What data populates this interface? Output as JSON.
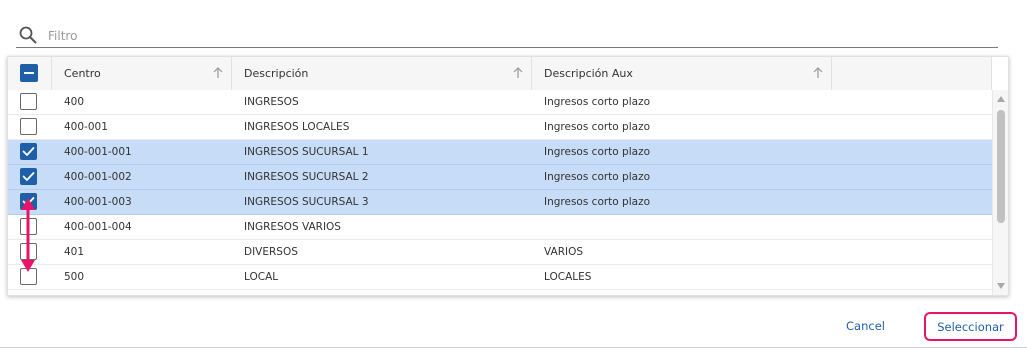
{
  "filter": {
    "placeholder": "Filtro",
    "value": ""
  },
  "grid": {
    "columns": [
      {
        "key": "centro",
        "label": "Centro",
        "sortable": true
      },
      {
        "key": "descripcion",
        "label": "Descripción",
        "sortable": true
      },
      {
        "key": "descripcion_aux",
        "label": "Descripción Aux",
        "sortable": true
      }
    ],
    "header_checkbox_state": "indeterminate",
    "rows": [
      {
        "centro": "400",
        "descripcion": "INGRESOS",
        "descripcion_aux": "Ingresos corto plazo",
        "selected": false
      },
      {
        "centro": "400-001",
        "descripcion": "INGRESOS LOCALES",
        "descripcion_aux": "Ingresos corto plazo",
        "selected": false
      },
      {
        "centro": "400-001-001",
        "descripcion": "INGRESOS SUCURSAL 1",
        "descripcion_aux": "Ingresos corto plazo",
        "selected": true
      },
      {
        "centro": "400-001-002",
        "descripcion": "INGRESOS SUCURSAL 2",
        "descripcion_aux": "Ingresos corto plazo",
        "selected": true
      },
      {
        "centro": "400-001-003",
        "descripcion": "INGRESOS SUCURSAL 3",
        "descripcion_aux": "Ingresos corto plazo",
        "selected": true
      },
      {
        "centro": "400-001-004",
        "descripcion": "INGRESOS VARIOS",
        "descripcion_aux": "",
        "selected": false
      },
      {
        "centro": "401",
        "descripcion": "DIVERSOS",
        "descripcion_aux": "VARIOS",
        "selected": false
      },
      {
        "centro": "500",
        "descripcion": "LOCAL",
        "descripcion_aux": "LOCALES",
        "selected": false
      }
    ]
  },
  "footer": {
    "cancel_label": "Cancel",
    "select_label": "Seleccionar"
  },
  "colors": {
    "accent": "#1f5fa8",
    "selected_row": "#c7dcf6",
    "annotation": "#e8146a"
  },
  "icons": {
    "filter": "search-icon",
    "sort": "arrow-up-icon",
    "checkbox_checked": "check-icon",
    "header_checkbox": "minus-icon"
  }
}
